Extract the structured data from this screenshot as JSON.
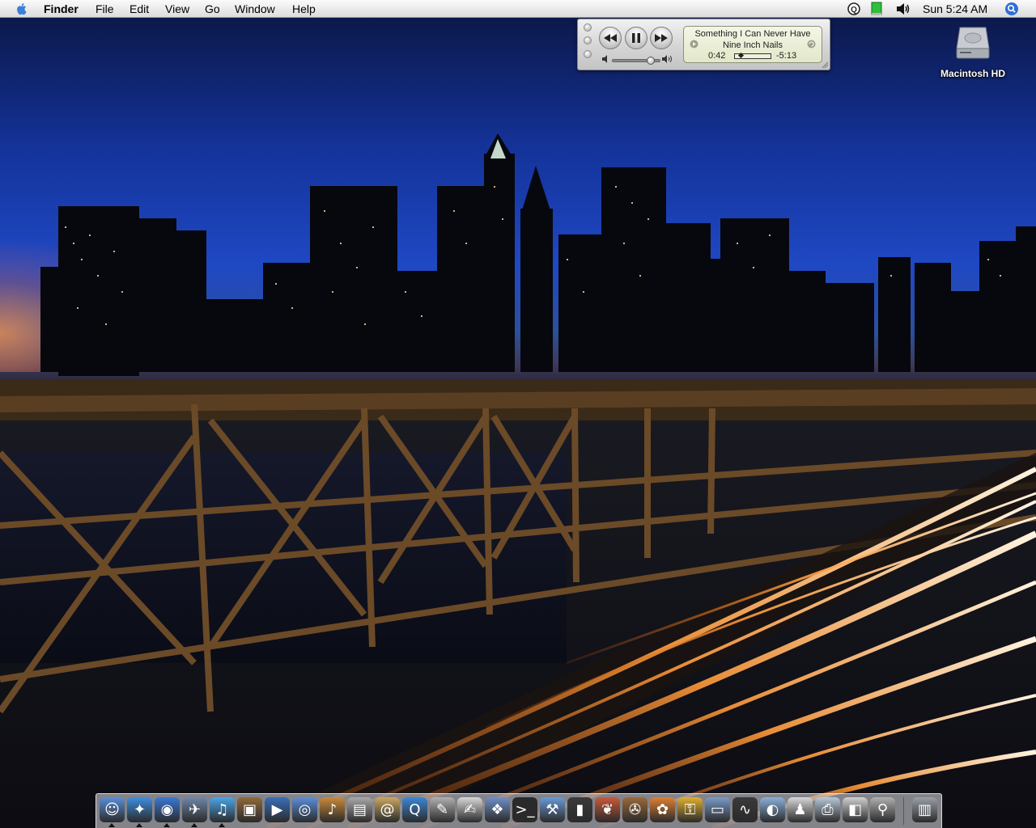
{
  "menubar": {
    "app_name": "Finder",
    "menus": [
      "File",
      "Edit",
      "View",
      "Go",
      "Window",
      "Help"
    ],
    "clock": "Sun 5:24 AM",
    "tray_icons": [
      "quicksilver-icon",
      "battery-icon",
      "volume-icon"
    ],
    "spotlight_icon": "spotlight-icon"
  },
  "itunes": {
    "song": "Something I Can Never Have",
    "artist": "Nine Inch Nails",
    "elapsed": "0:42",
    "remaining": "-5:13",
    "progress_fraction": 0.12,
    "volume_fraction": 0.82,
    "buttons": [
      "previous-icon",
      "pause-icon",
      "next-icon"
    ]
  },
  "desktop": {
    "hd_label": "Macintosh HD"
  },
  "dock": {
    "apps": [
      {
        "name": "finder",
        "glyph": "☺",
        "color": "#5a8fd8",
        "running": true
      },
      {
        "name": "safari",
        "glyph": "✦",
        "color": "#3d8fe0",
        "running": true
      },
      {
        "name": "ichat",
        "glyph": "◉",
        "color": "#3a78d6",
        "running": true
      },
      {
        "name": "mail",
        "glyph": "✈",
        "color": "#6f86a8",
        "running": true
      },
      {
        "name": "itunes",
        "glyph": "♫",
        "color": "#4aa6e8",
        "running": true
      },
      {
        "name": "iphoto",
        "glyph": "▣",
        "color": "#8f6a3a",
        "running": false
      },
      {
        "name": "imovie",
        "glyph": "▶",
        "color": "#3a6fb8",
        "running": false
      },
      {
        "name": "idvd",
        "glyph": "◎",
        "color": "#5b8ed8",
        "running": false
      },
      {
        "name": "garageband",
        "glyph": "♪",
        "color": "#c88a3a",
        "running": false
      },
      {
        "name": "preview",
        "glyph": "▤",
        "color": "#a9a9a9",
        "running": false
      },
      {
        "name": "address-book",
        "glyph": "@",
        "color": "#caa860",
        "running": false
      },
      {
        "name": "quicktime",
        "glyph": "Q",
        "color": "#3c86d6",
        "running": false
      },
      {
        "name": "utilities",
        "glyph": "✎",
        "color": "#b0b0b0",
        "running": false
      },
      {
        "name": "textedit",
        "glyph": "✍",
        "color": "#d8d8d8",
        "running": false
      },
      {
        "name": "image-capture",
        "glyph": "❖",
        "color": "#6f8fc8",
        "running": false
      },
      {
        "name": "terminal",
        "glyph": ">_",
        "color": "#2a2a2a",
        "running": false
      },
      {
        "name": "xcode",
        "glyph": "⚒",
        "color": "#6a9ad8",
        "running": false
      },
      {
        "name": "ipod-updater",
        "glyph": "▮",
        "color": "#3a3a3a",
        "running": false
      },
      {
        "name": "hairdryer",
        "glyph": "❦",
        "color": "#c85a3a",
        "running": false
      },
      {
        "name": "helm",
        "glyph": "✇",
        "color": "#9a6a3a",
        "running": false
      },
      {
        "name": "goldfish",
        "glyph": "✿",
        "color": "#e08030",
        "running": false
      },
      {
        "name": "keychain",
        "glyph": "⚿",
        "color": "#e0b030",
        "running": false
      },
      {
        "name": "system-profiler",
        "glyph": "▭",
        "color": "#7a9ac8",
        "running": false
      },
      {
        "name": "activity-monitor",
        "glyph": "∿",
        "color": "#3a3a3a",
        "running": false
      },
      {
        "name": "shell",
        "glyph": "◐",
        "color": "#8ab0d8",
        "running": false
      },
      {
        "name": "penguin",
        "glyph": "♟",
        "color": "#d8d8d8",
        "running": false
      },
      {
        "name": "printer",
        "glyph": "⎙",
        "color": "#b8c8d8",
        "running": false
      },
      {
        "name": "mac-mini",
        "glyph": "◧",
        "color": "#d0d0d0",
        "running": false
      },
      {
        "name": "brush",
        "glyph": "⚲",
        "color": "#b0b0b0",
        "running": false
      },
      {
        "name": "trash",
        "glyph": "▥",
        "color": "#9aa0a8",
        "running": false
      }
    ]
  }
}
